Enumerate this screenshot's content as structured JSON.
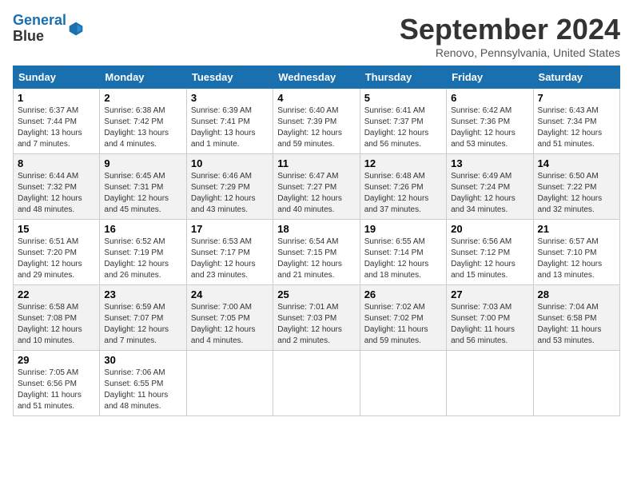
{
  "header": {
    "logo_line1": "General",
    "logo_line2": "Blue",
    "month_title": "September 2024",
    "location": "Renovo, Pennsylvania, United States"
  },
  "weekdays": [
    "Sunday",
    "Monday",
    "Tuesday",
    "Wednesday",
    "Thursday",
    "Friday",
    "Saturday"
  ],
  "weeks": [
    [
      {
        "day": "1",
        "sunrise": "6:37 AM",
        "sunset": "7:44 PM",
        "daylight": "13 hours and 7 minutes."
      },
      {
        "day": "2",
        "sunrise": "6:38 AM",
        "sunset": "7:42 PM",
        "daylight": "13 hours and 4 minutes."
      },
      {
        "day": "3",
        "sunrise": "6:39 AM",
        "sunset": "7:41 PM",
        "daylight": "13 hours and 1 minute."
      },
      {
        "day": "4",
        "sunrise": "6:40 AM",
        "sunset": "7:39 PM",
        "daylight": "12 hours and 59 minutes."
      },
      {
        "day": "5",
        "sunrise": "6:41 AM",
        "sunset": "7:37 PM",
        "daylight": "12 hours and 56 minutes."
      },
      {
        "day": "6",
        "sunrise": "6:42 AM",
        "sunset": "7:36 PM",
        "daylight": "12 hours and 53 minutes."
      },
      {
        "day": "7",
        "sunrise": "6:43 AM",
        "sunset": "7:34 PM",
        "daylight": "12 hours and 51 minutes."
      }
    ],
    [
      {
        "day": "8",
        "sunrise": "6:44 AM",
        "sunset": "7:32 PM",
        "daylight": "12 hours and 48 minutes."
      },
      {
        "day": "9",
        "sunrise": "6:45 AM",
        "sunset": "7:31 PM",
        "daylight": "12 hours and 45 minutes."
      },
      {
        "day": "10",
        "sunrise": "6:46 AM",
        "sunset": "7:29 PM",
        "daylight": "12 hours and 43 minutes."
      },
      {
        "day": "11",
        "sunrise": "6:47 AM",
        "sunset": "7:27 PM",
        "daylight": "12 hours and 40 minutes."
      },
      {
        "day": "12",
        "sunrise": "6:48 AM",
        "sunset": "7:26 PM",
        "daylight": "12 hours and 37 minutes."
      },
      {
        "day": "13",
        "sunrise": "6:49 AM",
        "sunset": "7:24 PM",
        "daylight": "12 hours and 34 minutes."
      },
      {
        "day": "14",
        "sunrise": "6:50 AM",
        "sunset": "7:22 PM",
        "daylight": "12 hours and 32 minutes."
      }
    ],
    [
      {
        "day": "15",
        "sunrise": "6:51 AM",
        "sunset": "7:20 PM",
        "daylight": "12 hours and 29 minutes."
      },
      {
        "day": "16",
        "sunrise": "6:52 AM",
        "sunset": "7:19 PM",
        "daylight": "12 hours and 26 minutes."
      },
      {
        "day": "17",
        "sunrise": "6:53 AM",
        "sunset": "7:17 PM",
        "daylight": "12 hours and 23 minutes."
      },
      {
        "day": "18",
        "sunrise": "6:54 AM",
        "sunset": "7:15 PM",
        "daylight": "12 hours and 21 minutes."
      },
      {
        "day": "19",
        "sunrise": "6:55 AM",
        "sunset": "7:14 PM",
        "daylight": "12 hours and 18 minutes."
      },
      {
        "day": "20",
        "sunrise": "6:56 AM",
        "sunset": "7:12 PM",
        "daylight": "12 hours and 15 minutes."
      },
      {
        "day": "21",
        "sunrise": "6:57 AM",
        "sunset": "7:10 PM",
        "daylight": "12 hours and 13 minutes."
      }
    ],
    [
      {
        "day": "22",
        "sunrise": "6:58 AM",
        "sunset": "7:08 PM",
        "daylight": "12 hours and 10 minutes."
      },
      {
        "day": "23",
        "sunrise": "6:59 AM",
        "sunset": "7:07 PM",
        "daylight": "12 hours and 7 minutes."
      },
      {
        "day": "24",
        "sunrise": "7:00 AM",
        "sunset": "7:05 PM",
        "daylight": "12 hours and 4 minutes."
      },
      {
        "day": "25",
        "sunrise": "7:01 AM",
        "sunset": "7:03 PM",
        "daylight": "12 hours and 2 minutes."
      },
      {
        "day": "26",
        "sunrise": "7:02 AM",
        "sunset": "7:02 PM",
        "daylight": "11 hours and 59 minutes."
      },
      {
        "day": "27",
        "sunrise": "7:03 AM",
        "sunset": "7:00 PM",
        "daylight": "11 hours and 56 minutes."
      },
      {
        "day": "28",
        "sunrise": "7:04 AM",
        "sunset": "6:58 PM",
        "daylight": "11 hours and 53 minutes."
      }
    ],
    [
      {
        "day": "29",
        "sunrise": "7:05 AM",
        "sunset": "6:56 PM",
        "daylight": "11 hours and 51 minutes."
      },
      {
        "day": "30",
        "sunrise": "7:06 AM",
        "sunset": "6:55 PM",
        "daylight": "11 hours and 48 minutes."
      },
      null,
      null,
      null,
      null,
      null
    ]
  ]
}
